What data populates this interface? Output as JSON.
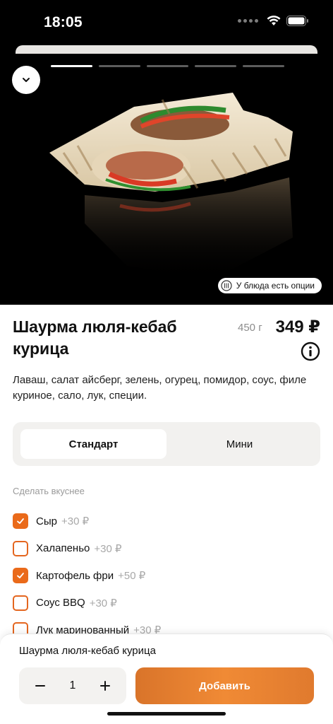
{
  "status_bar": {
    "time": "18:05"
  },
  "gallery": {
    "slides_total": 5,
    "active_slide": 1
  },
  "options_badge": "У блюда есть опции",
  "product": {
    "title": "Шаурма люля-кебаб курица",
    "weight": "450 г",
    "price": "349 ₽",
    "description": "Лаваш, салат айсберг, зелень, огурец, помидор, соус, филе куриное, сало, лук, специи."
  },
  "size_options": [
    {
      "label": "Стандарт",
      "selected": true
    },
    {
      "label": "Мини",
      "selected": false
    }
  ],
  "addons_section_label": "Сделать вкуснее",
  "addons": [
    {
      "name": "Сыр",
      "price": "+30 ₽",
      "checked": true
    },
    {
      "name": "Халапеньо",
      "price": "+30 ₽",
      "checked": false
    },
    {
      "name": "Картофель фри",
      "price": "+50 ₽",
      "checked": true
    },
    {
      "name": "Соус BBQ",
      "price": "+30 ₽",
      "checked": false
    },
    {
      "name": "Лук маринованный",
      "price": "+30 ₽",
      "checked": false
    }
  ],
  "cart_panel": {
    "title": "Шаурма люля-кебаб курица",
    "quantity": "1",
    "add_label": "Добавить"
  },
  "colors": {
    "accent": "#ea6a1a",
    "button_gradient_start": "#d9742a",
    "button_gradient_end": "#f08a35"
  }
}
